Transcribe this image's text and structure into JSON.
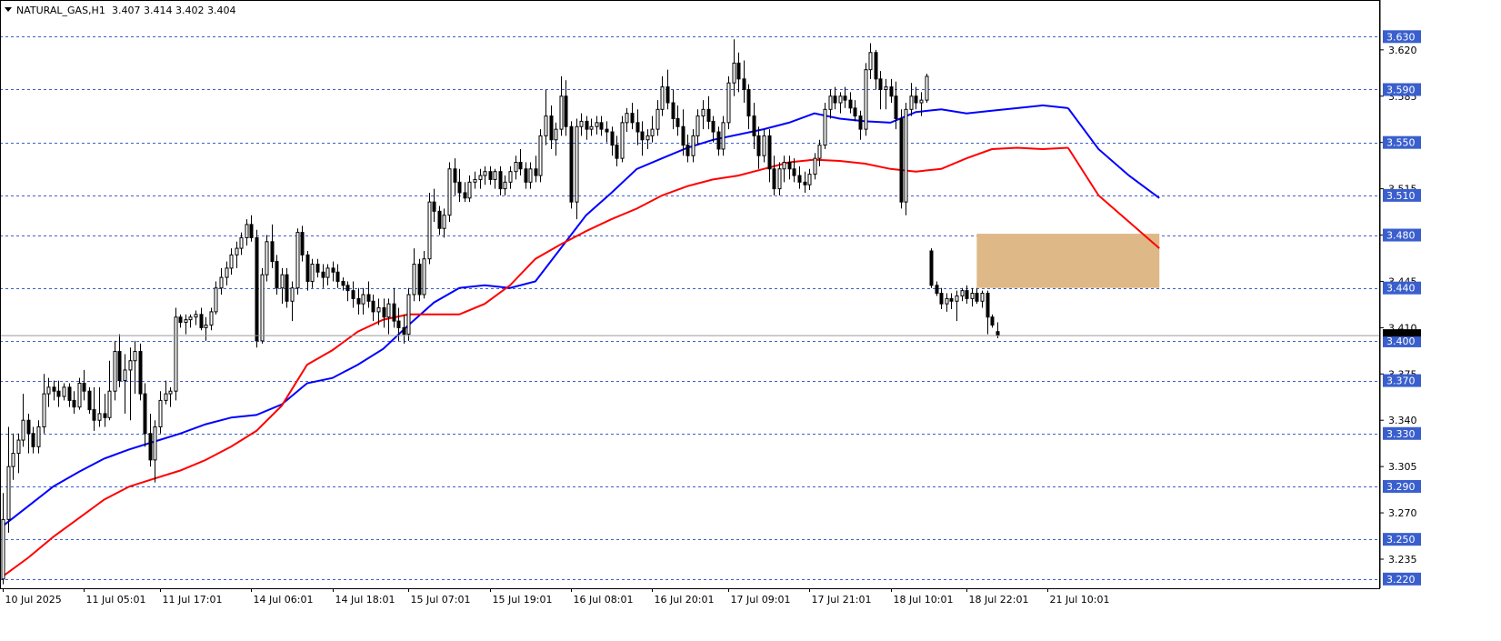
{
  "header": {
    "symbol_label": "NATURAL_GAS,H1",
    "ohlc_label": "3.407 3.414 3.402 3.404"
  },
  "chart_data": {
    "type": "candlestick",
    "symbol": "NATURAL_GAS",
    "timeframe": "H1",
    "last_ohlc": {
      "open": 3.407,
      "high": 3.414,
      "low": 3.402,
      "close": 3.404
    },
    "current_price": 3.404,
    "ylim": [
      3.213,
      3.657
    ],
    "y_ticks": [
      3.62,
      3.585,
      3.55,
      3.515,
      3.48,
      3.445,
      3.41,
      3.375,
      3.34,
      3.305,
      3.27,
      3.235
    ],
    "y_tick_labels": [
      "3.620",
      "3.585",
      "3.550",
      "3.515",
      "3.480",
      "3.445",
      "3.410",
      "3.375",
      "3.340",
      "3.305",
      "3.270",
      "3.235"
    ],
    "x_tick_labels": [
      "10 Jul 2025",
      "11 Jul 05:01",
      "11 Jul 17:01",
      "14 Jul 06:01",
      "14 Jul 18:01",
      "15 Jul 07:01",
      "15 Jul 19:01",
      "16 Jul 08:01",
      "16 Jul 20:01",
      "17 Jul 09:01",
      "17 Jul 21:01",
      "18 Jul 10:01",
      "18 Jul 22:01",
      "21 Jul 10:01"
    ],
    "x_tick_bars": [
      0,
      16,
      31,
      49,
      65,
      80,
      96,
      112,
      128,
      143,
      159,
      175,
      190,
      206
    ],
    "horizontal_levels": [
      {
        "value": 3.63,
        "label": "3.630"
      },
      {
        "value": 3.59,
        "label": "3.590"
      },
      {
        "value": 3.55,
        "label": "3.550"
      },
      {
        "value": 3.51,
        "label": "3.510"
      },
      {
        "value": 3.48,
        "label": "3.480"
      },
      {
        "value": 3.44,
        "label": "3.440"
      },
      {
        "value": 3.4,
        "label": "3.400"
      },
      {
        "value": 3.37,
        "label": "3.370"
      },
      {
        "value": 3.33,
        "label": "3.330"
      },
      {
        "value": 3.29,
        "label": "3.290"
      },
      {
        "value": 3.25,
        "label": "3.250"
      },
      {
        "value": 3.22,
        "label": "3.220"
      }
    ],
    "zone": {
      "from": 3.44,
      "to": 3.481,
      "start_bar": 192,
      "end_bar": 228,
      "color": "#deb887"
    },
    "candles": [
      [
        3.22,
        3.285,
        3.216,
        3.265
      ],
      [
        3.265,
        3.335,
        3.255,
        3.305
      ],
      [
        3.305,
        3.33,
        3.295,
        3.315
      ],
      [
        3.315,
        3.33,
        3.3,
        3.325
      ],
      [
        3.325,
        3.36,
        3.32,
        3.34
      ],
      [
        3.34,
        3.345,
        3.315,
        3.33
      ],
      [
        3.33,
        3.335,
        3.315,
        3.32
      ],
      [
        3.32,
        3.34,
        3.315,
        3.335
      ],
      [
        3.335,
        3.375,
        3.33,
        3.36
      ],
      [
        3.36,
        3.372,
        3.35,
        3.365
      ],
      [
        3.365,
        3.37,
        3.355,
        3.362
      ],
      [
        3.362,
        3.37,
        3.35,
        3.358
      ],
      [
        3.358,
        3.368,
        3.355,
        3.365
      ],
      [
        3.365,
        3.368,
        3.35,
        3.355
      ],
      [
        3.355,
        3.362,
        3.345,
        3.35
      ],
      [
        3.35,
        3.372,
        3.348,
        3.368
      ],
      [
        3.368,
        3.378,
        3.355,
        3.362
      ],
      [
        3.362,
        3.365,
        3.345,
        3.348
      ],
      [
        3.348,
        3.365,
        3.332,
        3.34
      ],
      [
        3.34,
        3.365,
        3.335,
        3.345
      ],
      [
        3.345,
        3.36,
        3.335,
        3.342
      ],
      [
        3.342,
        3.385,
        3.34,
        3.362
      ],
      [
        3.362,
        3.4,
        3.355,
        3.392
      ],
      [
        3.392,
        3.405,
        3.365,
        3.37
      ],
      [
        3.37,
        3.39,
        3.345,
        3.378
      ],
      [
        3.378,
        3.395,
        3.34,
        3.385
      ],
      [
        3.385,
        3.4,
        3.36,
        3.392
      ],
      [
        3.392,
        3.398,
        3.355,
        3.36
      ],
      [
        3.36,
        3.368,
        3.32,
        3.33
      ],
      [
        3.33,
        3.345,
        3.305,
        3.31
      ],
      [
        3.31,
        3.34,
        3.293,
        3.335
      ],
      [
        3.335,
        3.362,
        3.33,
        3.355
      ],
      [
        3.355,
        3.37,
        3.352,
        3.36
      ],
      [
        3.36,
        3.365,
        3.35,
        3.362
      ],
      [
        3.362,
        3.425,
        3.355,
        3.418
      ],
      [
        3.418,
        3.42,
        3.41,
        3.414
      ],
      [
        3.414,
        3.42,
        3.405,
        3.416
      ],
      [
        3.416,
        3.42,
        3.41,
        3.418
      ],
      [
        3.418,
        3.423,
        3.412,
        3.42
      ],
      [
        3.42,
        3.425,
        3.408,
        3.41
      ],
      [
        3.41,
        3.418,
        3.4,
        3.412
      ],
      [
        3.412,
        3.425,
        3.408,
        3.422
      ],
      [
        3.422,
        3.445,
        3.42,
        3.44
      ],
      [
        3.44,
        3.455,
        3.435,
        3.448
      ],
      [
        3.448,
        3.46,
        3.442,
        3.455
      ],
      [
        3.455,
        3.47,
        3.45,
        3.465
      ],
      [
        3.465,
        3.475,
        3.455,
        3.47
      ],
      [
        3.47,
        3.482,
        3.465,
        3.478
      ],
      [
        3.478,
        3.492,
        3.472,
        3.488
      ],
      [
        3.488,
        3.495,
        3.475,
        3.478
      ],
      [
        3.478,
        3.484,
        3.395,
        3.4
      ],
      [
        3.4,
        3.455,
        3.398,
        3.45
      ],
      [
        3.45,
        3.48,
        3.445,
        3.475
      ],
      [
        3.475,
        3.488,
        3.455,
        3.46
      ],
      [
        3.46,
        3.465,
        3.435,
        3.44
      ],
      [
        3.44,
        3.455,
        3.428,
        3.45
      ],
      [
        3.45,
        3.455,
        3.425,
        3.43
      ],
      [
        3.43,
        3.445,
        3.415,
        3.44
      ],
      [
        3.44,
        3.485,
        3.435,
        3.482
      ],
      [
        3.482,
        3.487,
        3.46,
        3.465
      ],
      [
        3.465,
        3.468,
        3.438,
        3.445
      ],
      [
        3.445,
        3.462,
        3.44,
        3.458
      ],
      [
        3.458,
        3.462,
        3.448,
        3.452
      ],
      [
        3.452,
        3.458,
        3.44,
        3.448
      ],
      [
        3.448,
        3.458,
        3.442,
        3.455
      ],
      [
        3.455,
        3.46,
        3.445,
        3.452
      ],
      [
        3.452,
        3.458,
        3.44,
        3.445
      ],
      [
        3.445,
        3.448,
        3.438,
        3.442
      ],
      [
        3.442,
        3.445,
        3.43,
        3.438
      ],
      [
        3.438,
        3.445,
        3.425,
        3.432
      ],
      [
        3.432,
        3.44,
        3.42,
        3.428
      ],
      [
        3.428,
        3.44,
        3.42,
        3.435
      ],
      [
        3.435,
        3.445,
        3.425,
        3.43
      ],
      [
        3.43,
        3.435,
        3.415,
        3.422
      ],
      [
        3.422,
        3.432,
        3.412,
        3.425
      ],
      [
        3.425,
        3.432,
        3.41,
        3.418
      ],
      [
        3.418,
        3.432,
        3.405,
        3.428
      ],
      [
        3.428,
        3.44,
        3.41,
        3.415
      ],
      [
        3.415,
        3.425,
        3.4,
        3.41
      ],
      [
        3.41,
        3.42,
        3.398,
        3.405
      ],
      [
        3.405,
        3.44,
        3.4,
        3.435
      ],
      [
        3.435,
        3.47,
        3.43,
        3.458
      ],
      [
        3.458,
        3.462,
        3.43,
        3.435
      ],
      [
        3.435,
        3.468,
        3.432,
        3.462
      ],
      [
        3.462,
        3.512,
        3.458,
        3.505
      ],
      [
        3.505,
        3.515,
        3.49,
        3.498
      ],
      [
        3.498,
        3.502,
        3.48,
        3.485
      ],
      [
        3.485,
        3.5,
        3.478,
        3.495
      ],
      [
        3.495,
        3.535,
        3.49,
        3.53
      ],
      [
        3.53,
        3.538,
        3.51,
        3.52
      ],
      [
        3.52,
        3.53,
        3.505,
        3.512
      ],
      [
        3.512,
        3.52,
        3.505,
        3.508
      ],
      [
        3.508,
        3.525,
        3.505,
        3.52
      ],
      [
        3.52,
        3.528,
        3.515,
        3.522
      ],
      [
        3.522,
        3.53,
        3.515,
        3.525
      ],
      [
        3.525,
        3.532,
        3.518,
        3.528
      ],
      [
        3.528,
        3.532,
        3.518,
        3.522
      ],
      [
        3.522,
        3.53,
        3.515,
        3.528
      ],
      [
        3.528,
        3.532,
        3.51,
        3.515
      ],
      [
        3.515,
        3.525,
        3.51,
        3.52
      ],
      [
        3.52,
        3.532,
        3.515,
        3.528
      ],
      [
        3.528,
        3.54,
        3.522,
        3.535
      ],
      [
        3.535,
        3.545,
        3.525,
        3.53
      ],
      [
        3.53,
        3.535,
        3.515,
        3.52
      ],
      [
        3.52,
        3.535,
        3.515,
        3.53
      ],
      [
        3.53,
        3.54,
        3.52,
        3.525
      ],
      [
        3.525,
        3.56,
        3.52,
        3.555
      ],
      [
        3.555,
        3.59,
        3.548,
        3.57
      ],
      [
        3.57,
        3.578,
        3.545,
        3.552
      ],
      [
        3.552,
        3.565,
        3.54,
        3.56
      ],
      [
        3.56,
        3.6,
        3.555,
        3.585
      ],
      [
        3.585,
        3.597,
        3.555,
        3.562
      ],
      [
        3.562,
        3.566,
        3.5,
        3.505
      ],
      [
        3.505,
        3.568,
        3.492,
        3.562
      ],
      [
        3.562,
        3.572,
        3.555,
        3.566
      ],
      [
        3.566,
        3.57,
        3.552,
        3.56
      ],
      [
        3.56,
        3.568,
        3.555,
        3.562
      ],
      [
        3.562,
        3.57,
        3.556,
        3.565
      ],
      [
        3.565,
        3.57,
        3.555,
        3.56
      ],
      [
        3.56,
        3.566,
        3.55,
        3.558
      ],
      [
        3.558,
        3.562,
        3.54,
        3.548
      ],
      [
        3.548,
        3.555,
        3.532,
        3.538
      ],
      [
        3.538,
        3.57,
        3.535,
        3.565
      ],
      [
        3.565,
        3.576,
        3.558,
        3.572
      ],
      [
        3.572,
        3.58,
        3.56,
        3.565
      ],
      [
        3.565,
        3.575,
        3.548,
        3.558
      ],
      [
        3.558,
        3.566,
        3.54,
        3.552
      ],
      [
        3.552,
        3.56,
        3.545,
        3.555
      ],
      [
        3.555,
        3.57,
        3.55,
        3.56
      ],
      [
        3.56,
        3.582,
        3.555,
        3.575
      ],
      [
        3.575,
        3.6,
        3.57,
        3.592
      ],
      [
        3.592,
        3.605,
        3.575,
        3.58
      ],
      [
        3.58,
        3.59,
        3.56,
        3.568
      ],
      [
        3.568,
        3.578,
        3.555,
        3.562
      ],
      [
        3.562,
        3.575,
        3.54,
        3.548
      ],
      [
        3.548,
        3.556,
        3.535,
        3.54
      ],
      [
        3.54,
        3.56,
        3.535,
        3.555
      ],
      [
        3.555,
        3.575,
        3.548,
        3.57
      ],
      [
        3.57,
        3.582,
        3.56,
        3.575
      ],
      [
        3.575,
        3.585,
        3.56,
        3.566
      ],
      [
        3.566,
        3.57,
        3.55,
        3.558
      ],
      [
        3.558,
        3.562,
        3.54,
        3.545
      ],
      [
        3.545,
        3.57,
        3.54,
        3.565
      ],
      [
        3.565,
        3.6,
        3.56,
        3.595
      ],
      [
        3.595,
        3.628,
        3.585,
        3.61
      ],
      [
        3.61,
        3.618,
        3.588,
        3.598
      ],
      [
        3.598,
        3.612,
        3.58,
        3.59
      ],
      [
        3.59,
        3.594,
        3.56,
        3.57
      ],
      [
        3.57,
        3.58,
        3.545,
        3.555
      ],
      [
        3.555,
        3.562,
        3.53,
        3.54
      ],
      [
        3.54,
        3.56,
        3.535,
        3.555
      ],
      [
        3.555,
        3.56,
        3.52,
        3.53
      ],
      [
        3.53,
        3.54,
        3.51,
        3.515
      ],
      [
        3.515,
        3.535,
        3.51,
        3.53
      ],
      [
        3.53,
        3.54,
        3.52,
        3.535
      ],
      [
        3.535,
        3.54,
        3.522,
        3.53
      ],
      [
        3.53,
        3.538,
        3.52,
        3.525
      ],
      [
        3.525,
        3.532,
        3.515,
        3.52
      ],
      [
        3.52,
        3.528,
        3.512,
        3.518
      ],
      [
        3.518,
        3.53,
        3.514,
        3.526
      ],
      [
        3.526,
        3.542,
        3.522,
        3.538
      ],
      [
        3.538,
        3.552,
        3.532,
        3.548
      ],
      [
        3.548,
        3.58,
        3.545,
        3.575
      ],
      [
        3.575,
        3.59,
        3.568,
        3.585
      ],
      [
        3.585,
        3.592,
        3.575,
        3.58
      ],
      [
        3.58,
        3.588,
        3.572,
        3.585
      ],
      [
        3.585,
        3.592,
        3.576,
        3.582
      ],
      [
        3.582,
        3.588,
        3.572,
        3.576
      ],
      [
        3.576,
        3.582,
        3.566,
        3.57
      ],
      [
        3.57,
        3.574,
        3.552,
        3.56
      ],
      [
        3.56,
        3.61,
        3.555,
        3.605
      ],
      [
        3.605,
        3.625,
        3.598,
        3.618
      ],
      [
        3.618,
        3.62,
        3.59,
        3.598
      ],
      [
        3.598,
        3.604,
        3.575,
        3.59
      ],
      [
        3.59,
        3.598,
        3.575,
        3.592
      ],
      [
        3.592,
        3.598,
        3.58,
        3.585
      ],
      [
        3.585,
        3.596,
        3.56,
        3.568
      ],
      [
        3.568,
        3.575,
        3.5,
        3.505
      ],
      [
        3.505,
        3.58,
        3.495,
        3.575
      ],
      [
        3.575,
        3.595,
        3.57,
        3.585
      ],
      [
        3.585,
        3.592,
        3.575,
        3.58
      ],
      [
        3.58,
        3.588,
        3.57,
        3.582
      ],
      [
        3.582,
        3.602,
        3.58,
        3.6
      ],
      [
        3.468,
        3.47,
        3.44,
        3.442
      ],
      [
        3.442,
        3.445,
        3.434,
        3.436
      ],
      [
        3.436,
        3.44,
        3.424,
        3.428
      ],
      [
        3.428,
        3.436,
        3.422,
        3.432
      ],
      [
        3.432,
        3.436,
        3.424,
        3.43
      ],
      [
        3.43,
        3.438,
        3.415,
        3.434
      ],
      [
        3.434,
        3.44,
        3.43,
        3.438
      ],
      [
        3.438,
        3.442,
        3.428,
        3.432
      ],
      [
        3.432,
        3.44,
        3.426,
        3.436
      ],
      [
        3.436,
        3.44,
        3.428,
        3.43
      ],
      [
        3.43,
        3.438,
        3.425,
        3.436
      ],
      [
        3.436,
        3.438,
        3.405,
        3.418
      ],
      [
        3.418,
        3.42,
        3.41,
        3.412
      ],
      [
        3.407,
        3.414,
        3.402,
        3.404
      ]
    ],
    "ma_blue": [
      3.26,
      3.275,
      3.29,
      3.301,
      3.311,
      3.318,
      3.324,
      3.33,
      3.337,
      3.342,
      3.344,
      3.352,
      3.368,
      3.372,
      3.382,
      3.394,
      3.412,
      3.429,
      3.44,
      3.442,
      3.44,
      3.445,
      3.47,
      3.495,
      3.512,
      3.53,
      3.538,
      3.546,
      3.552,
      3.556,
      3.56,
      3.565,
      3.572,
      3.568,
      3.566,
      3.565,
      3.573,
      3.575,
      3.572,
      3.574,
      3.576,
      3.578,
      3.576
    ],
    "ma_red": [
      3.222,
      3.236,
      3.252,
      3.266,
      3.28,
      3.29,
      3.296,
      3.302,
      3.31,
      3.32,
      3.332,
      3.351,
      3.382,
      3.393,
      3.407,
      3.416,
      3.42,
      3.42,
      3.42,
      3.428,
      3.442,
      3.462,
      3.473,
      3.483,
      3.492,
      3.5,
      3.51,
      3.517,
      3.522,
      3.525,
      3.53,
      3.535,
      3.537,
      3.536,
      3.534,
      3.53,
      3.528,
      3.53,
      3.538,
      3.545,
      3.546,
      3.545,
      3.546
    ],
    "ma_future_blue": [
      3.576,
      3.545,
      3.525,
      3.508
    ],
    "ma_future_red": [
      3.546,
      3.51,
      3.49,
      3.47
    ]
  }
}
